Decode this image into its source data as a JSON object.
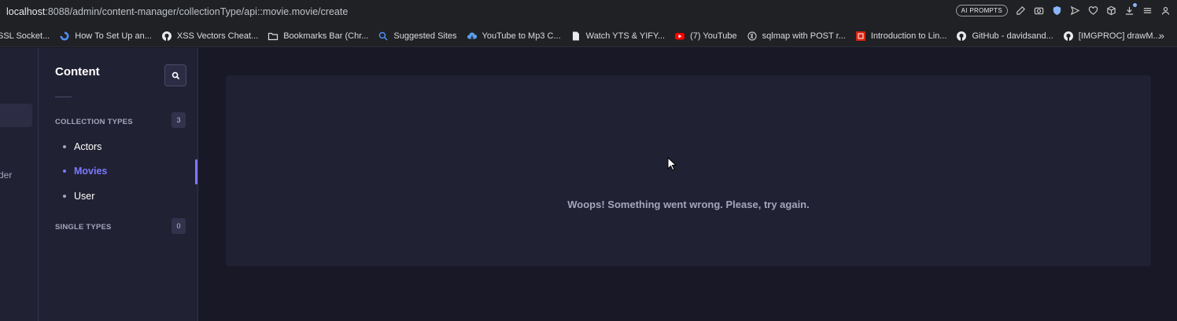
{
  "browser": {
    "url_host": "localhost",
    "url_rest": ":8088/admin/content-manager/collectionType/api::movie.movie/create",
    "ai_badge": "AI PROMPTS"
  },
  "bookmarks": [
    {
      "label": "SSL Socket...",
      "icon": "none"
    },
    {
      "label": "How To Set Up an...",
      "icon": "digitalocean-icon"
    },
    {
      "label": "XSS Vectors Cheat...",
      "icon": "github-icon"
    },
    {
      "label": "Bookmarks Bar (Chr...",
      "icon": "folder-icon"
    },
    {
      "label": "Suggested Sites",
      "icon": "search-icon"
    },
    {
      "label": "YouTube to Mp3 C...",
      "icon": "cloud-download-icon"
    },
    {
      "label": "Watch YTS & YIFY...",
      "icon": "file-icon"
    },
    {
      "label": "(7) YouTube",
      "icon": "youtube-icon"
    },
    {
      "label": "sqlmap with POST r...",
      "icon": "sqlmap-icon"
    },
    {
      "label": "Introduction to Lin...",
      "icon": "red-logo-icon"
    },
    {
      "label": "GitHub - davidsand...",
      "icon": "github-icon"
    },
    {
      "label": "[IMGPROC] drawM...",
      "icon": "github-icon"
    }
  ],
  "leftnav": {
    "cut_text": "der"
  },
  "content_nav": {
    "title": "Content",
    "collection_types": {
      "label": "COLLECTION TYPES",
      "count": "3",
      "items": [
        {
          "label": "Actors"
        },
        {
          "label": "Movies"
        },
        {
          "label": "User"
        }
      ]
    },
    "single_types": {
      "label": "SINGLE TYPES",
      "count": "0"
    }
  },
  "main": {
    "error_message": "Woops! Something went wrong. Please, try again."
  },
  "colors": {
    "accent": "#7b79ff",
    "panel": "#212134",
    "background": "#181826"
  }
}
